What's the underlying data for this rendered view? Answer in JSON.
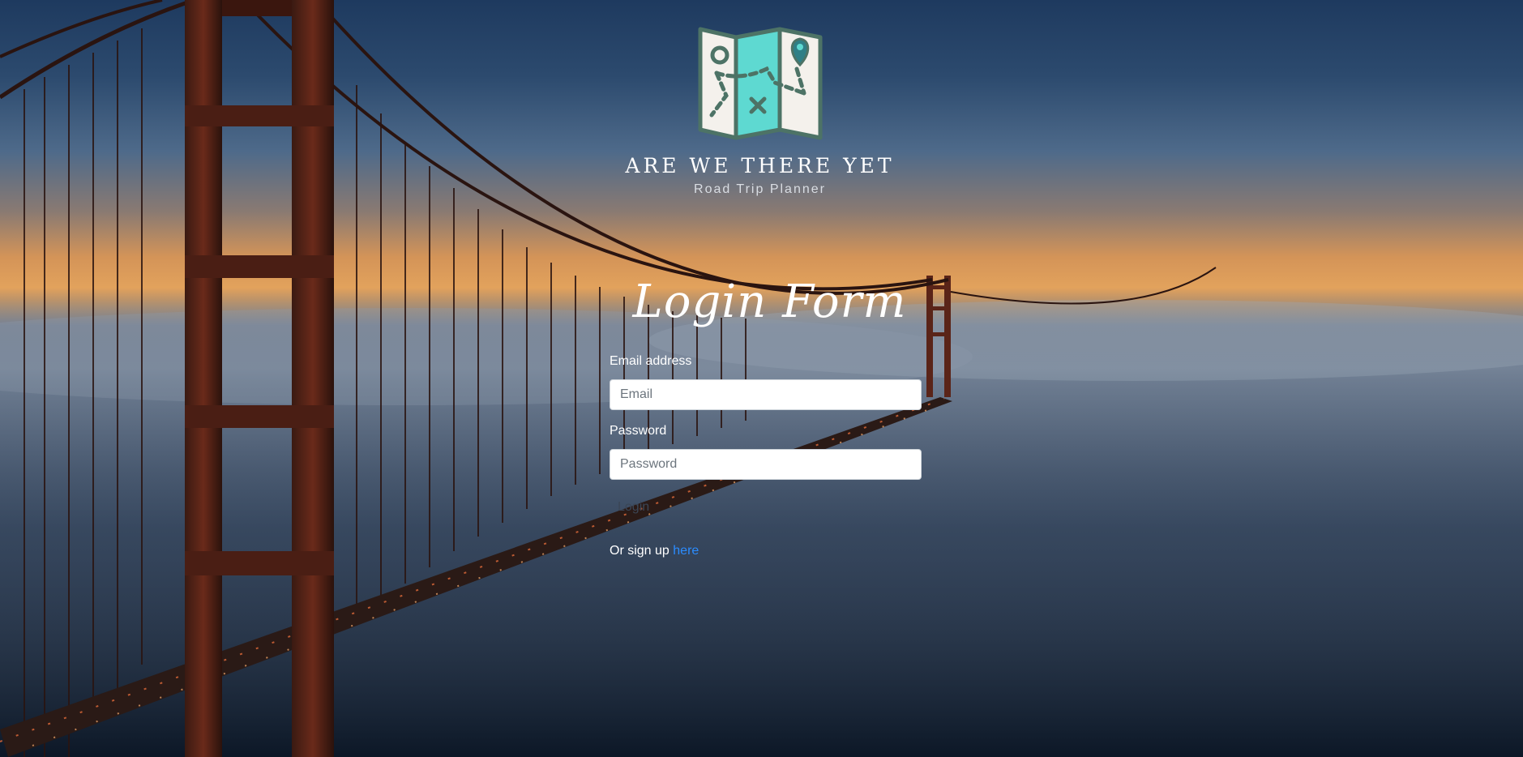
{
  "brand": {
    "title": "ARE WE THERE YET",
    "subtitle": "Road Trip Planner",
    "logo_icon": "folded-map-icon"
  },
  "form": {
    "title": "Login Form",
    "email_label": "Email address",
    "email_placeholder": "Email",
    "email_value": "",
    "password_label": "Password",
    "password_placeholder": "Password",
    "password_value": "",
    "login_label": "Login",
    "signup_prefix": "Or sign up ",
    "signup_link": "here"
  },
  "colors": {
    "link": "#2b8cff",
    "map_teal": "#5ed9d1",
    "map_outline": "#4d7366",
    "map_paper": "#f4f1ec"
  }
}
